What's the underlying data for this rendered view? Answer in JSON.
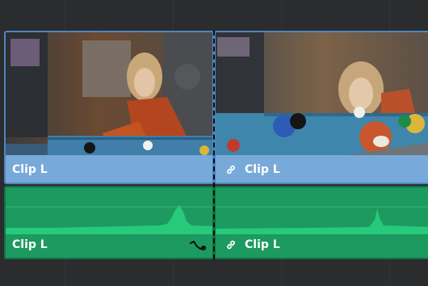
{
  "timeline": {
    "video_track": {
      "clips": [
        {
          "label": "Clip L",
          "linked": false
        },
        {
          "label": "Clip L",
          "linked": true
        }
      ]
    },
    "audio_track": {
      "clips": [
        {
          "label": "Clip L",
          "linked": false,
          "has_fade_handle": true
        },
        {
          "label": "Clip L",
          "linked": true
        }
      ]
    },
    "colors": {
      "video_clip": "#77a9d9",
      "audio_clip": "#1c9a5f",
      "waveform": "#25c878",
      "background": "#2b2c2e"
    }
  }
}
